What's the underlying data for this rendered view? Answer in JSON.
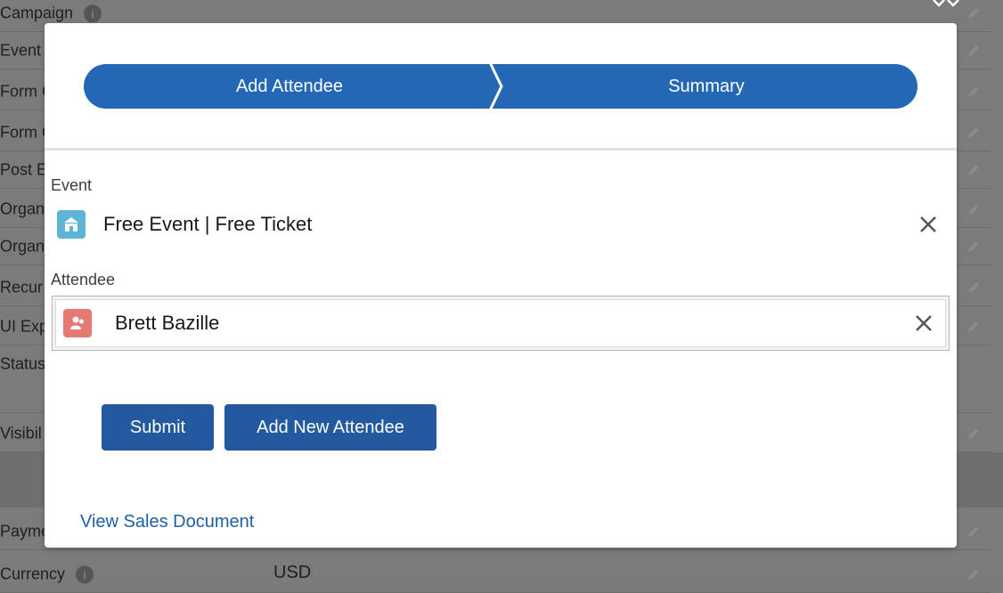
{
  "background": {
    "fields": [
      {
        "label": "Campaign",
        "info": true
      },
      {
        "label": "Event"
      },
      {
        "label": "Form C"
      },
      {
        "label": "Form C"
      },
      {
        "label": "Post E"
      },
      {
        "label": "Organ"
      },
      {
        "label": "Organ"
      },
      {
        "label": "Recur"
      },
      {
        "label": "UI Exp"
      },
      {
        "label": "Status"
      },
      {
        "label": "Visibil"
      },
      {
        "label": "Payme"
      },
      {
        "label": "Currency",
        "info": true
      }
    ],
    "currency_value": "USD",
    "info_glyph": "i"
  },
  "modal": {
    "path": {
      "steps": [
        "Add Attendee",
        "Summary"
      ]
    },
    "event": {
      "label": "Event",
      "value": "Free Event | Free Ticket",
      "icon": "event-icon"
    },
    "attendee": {
      "label": "Attendee",
      "value": "Brett Bazille",
      "icon": "contact-icon"
    },
    "buttons": {
      "submit": "Submit",
      "add_new": "Add New Attendee"
    },
    "link": "View Sales Document"
  },
  "colors": {
    "brand": "#2467b4",
    "button": "#23599f",
    "link": "#1f5fa5",
    "overlay": "#7b7b7b"
  }
}
